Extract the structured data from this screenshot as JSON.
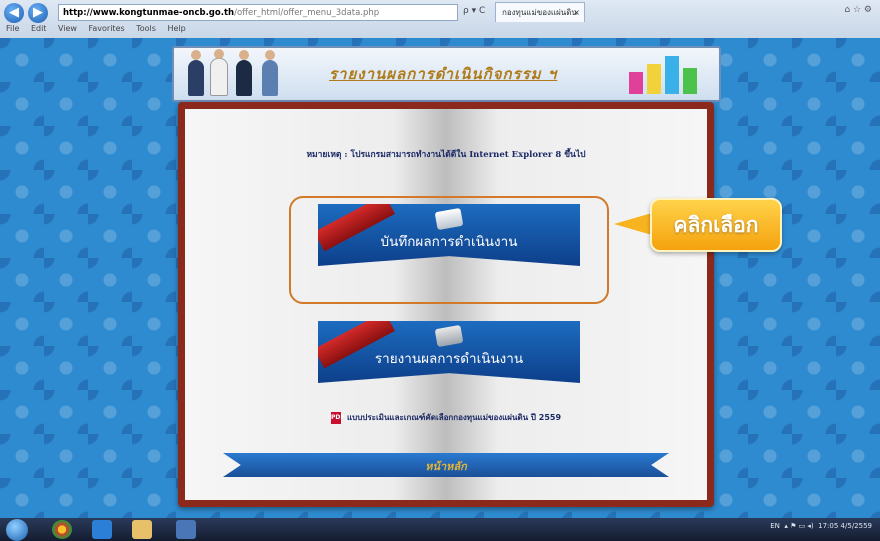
{
  "browser": {
    "address_domain": "http://www.kongtunmae-oncb.go.th",
    "address_path": "/offer_html/offer_menu_3data.php",
    "search_controls": "ρ ▾ C",
    "tab_title": "กองทุนแม่ของแผ่นดิน",
    "tab_close": "×",
    "window_controls": "⌂ ☆ ⚙",
    "menu": [
      "File",
      "Edit",
      "View",
      "Favorites",
      "Tools",
      "Help"
    ]
  },
  "header": {
    "title": "รายงานผลการดำเนินกิจกรรม ฯ"
  },
  "book": {
    "note": "หมายเหตุ : โปรแกรมสามารถทำงานได้ดีใน Internet Explorer 8 ขึ้นไป",
    "buttons": [
      {
        "label": "บันทึกผลการดำเนินงาน"
      },
      {
        "label": "รายงานผลการดำเนินงาน"
      }
    ],
    "pdf_icon": "PDF",
    "pdf_link": "แบบประเมินและเกณฑ์คัดเลือกกองทุนแม่ของแผ่นดิน ปี 2559",
    "bottom_label": "หน้าหลัก"
  },
  "callout": {
    "text": "คลิกเลือก"
  },
  "taskbar": {
    "tray_lang": "EN",
    "tray_time": "17:05",
    "tray_date": "4/5/2559"
  }
}
